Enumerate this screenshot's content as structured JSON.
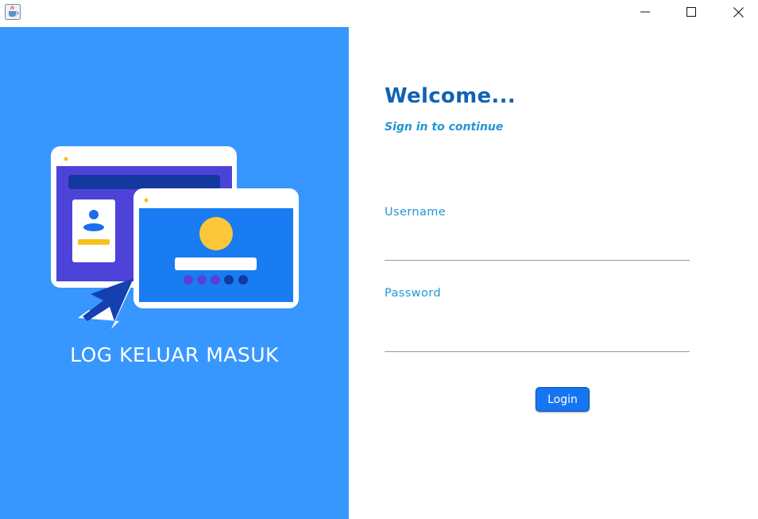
{
  "window": {
    "app_icon": "java-cup-icon",
    "controls": [
      "minimize",
      "maximize",
      "close"
    ]
  },
  "left_panel": {
    "background": "#3797fe",
    "brand_text": "LOG KELUAR MASUK",
    "illustration": "login-screens-illustration"
  },
  "form": {
    "welcome": "Welcome...",
    "subtitle": "Sign in to continue",
    "username_label": "Username",
    "username_value": "",
    "password_label": "Password",
    "password_value": "",
    "login_label": "Login",
    "accent": "#1262b3",
    "button_color": "#1676f2"
  }
}
